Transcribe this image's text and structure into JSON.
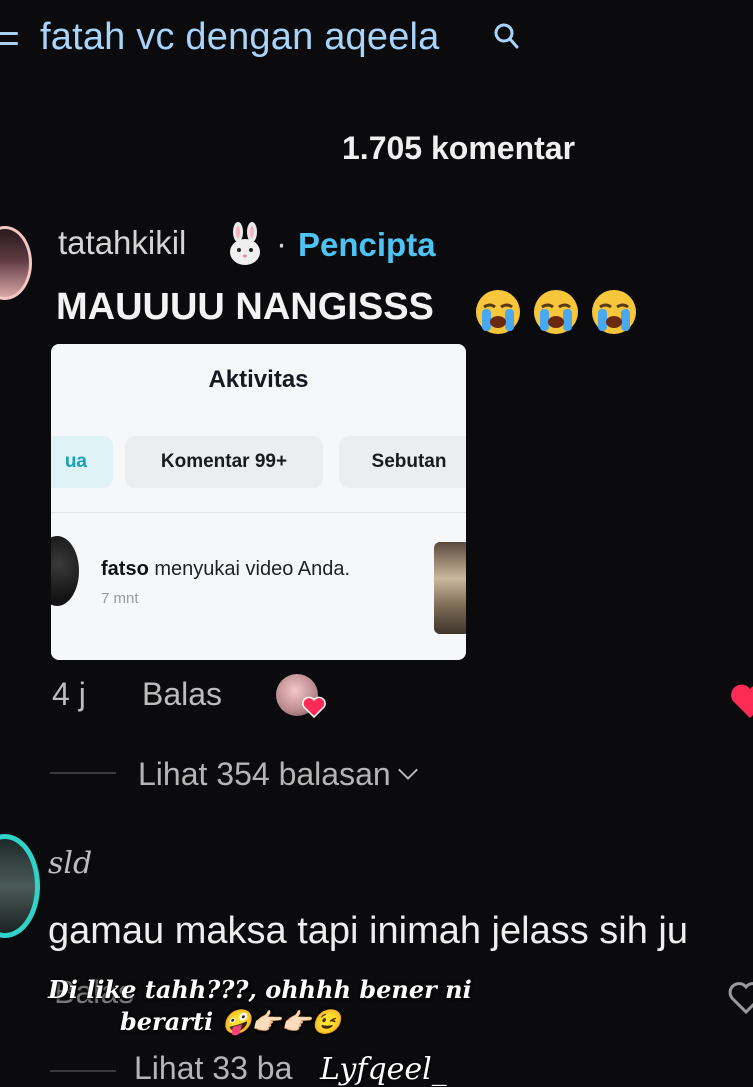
{
  "search": {
    "query": "fatah vc dengan aqeela"
  },
  "comments_header": {
    "count_label": "1.705 komentar"
  },
  "comment_1": {
    "username": "tatahkikil",
    "separator": "·",
    "badge": "Pencipta",
    "text": "MAUUUU NANGISSS",
    "time": "4 j",
    "reply_label": "Balas",
    "view_replies": "Lihat 354 balasan",
    "embedded_screenshot": {
      "title": "Aktivitas",
      "tabs": [
        "ua",
        "Komentar 99+",
        "Sebutan"
      ],
      "notification": {
        "user": "fatso",
        "action": " menyukai video Anda.",
        "time": "7 mnt"
      }
    }
  },
  "comment_2": {
    "username": "sld",
    "text": "gamau maksa tapi inimah jelass sih ju",
    "reply_label": "Balas",
    "view_replies": "Lihat 33 ba"
  },
  "overlay": {
    "caption_line1": "Di like tahh???, ohhhh bener ni",
    "caption_line2": "berarti",
    "watermark": "Lyfqeel_"
  },
  "colors": {
    "background": "#0b0b0d",
    "search_text": "#a8d4fb",
    "creator_badge": "#4dc3f3",
    "like_heart": "#ff2a55",
    "avatar_ring_2": "#2fd3c7"
  },
  "icons": [
    "menu-icon",
    "search-icon",
    "bunny-emoji",
    "crying-face-emoji",
    "heart-icon",
    "chevron-down-icon",
    "heart-outline-icon"
  ]
}
